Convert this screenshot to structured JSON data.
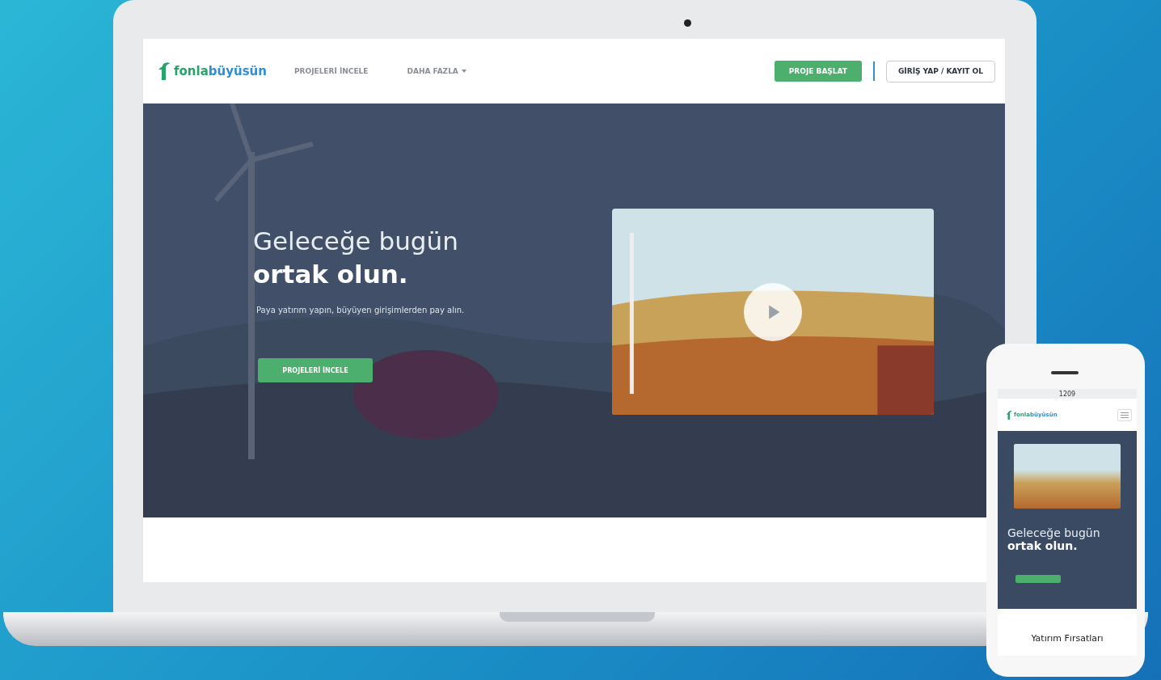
{
  "laptop": {
    "nav": {
      "logo": {
        "first": "fonla",
        "second": "büyüsün"
      },
      "links": [
        {
          "label": "PROJELERİ İNCELE",
          "dropdown": false
        },
        {
          "label": "DAHA FAZLA",
          "dropdown": true
        }
      ],
      "start_button": "PROJE BAŞLAT",
      "login_button": "GİRİŞ YAP / KAYIT OL"
    },
    "hero": {
      "title_light": "Geleceğe bugün",
      "title_bold": "ortak olun.",
      "subtitle": "Paya yatırım yapın, büyüyen girişimlerden pay alın.",
      "button": "PROJELERİ İNCELE"
    }
  },
  "phone": {
    "status_time": "1209",
    "logo": {
      "first": "fonla",
      "second": "büyüsün"
    },
    "title_light": "Geleceğe bugün",
    "title_bold": "ortak olun.",
    "section_title": "Yatırım Fırsatları"
  }
}
